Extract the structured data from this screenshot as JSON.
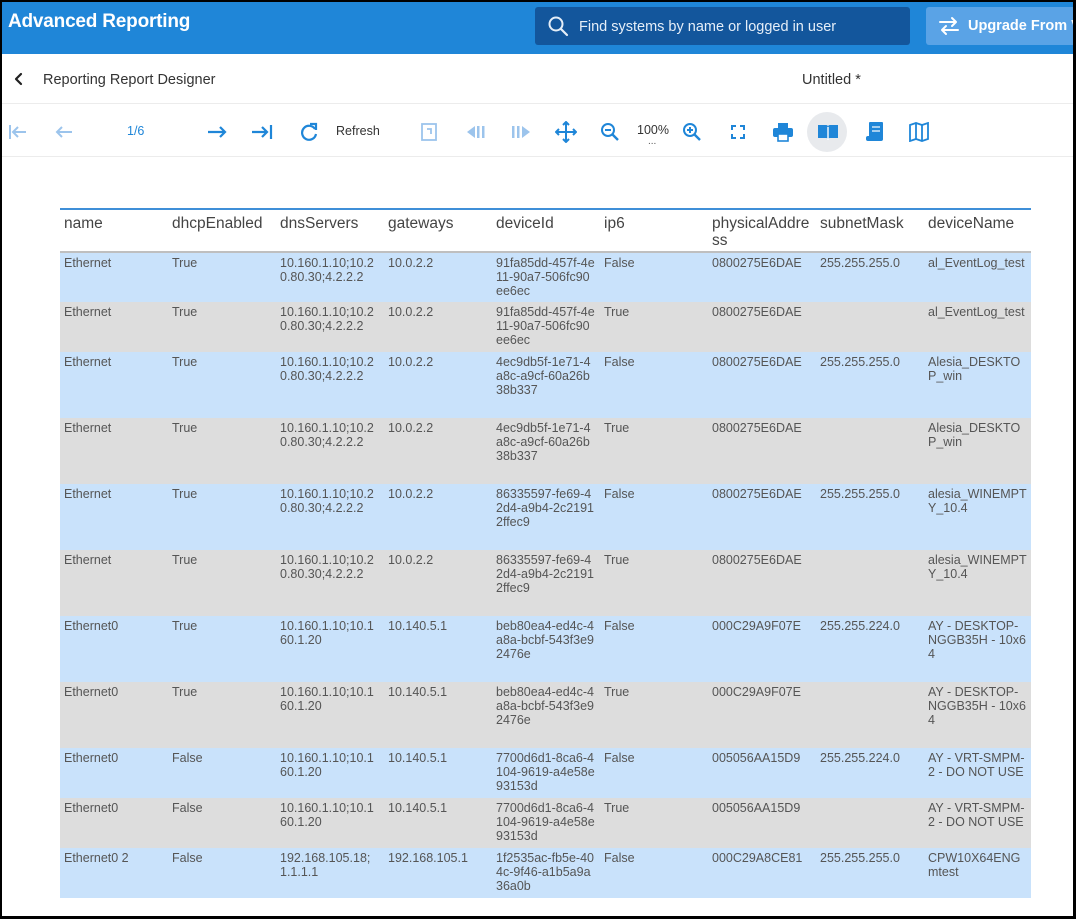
{
  "app": {
    "title": "Advanced Reporting",
    "search_placeholder": "Find systems by name or logged in user",
    "upgrade_label": "Upgrade From V..."
  },
  "subheader": {
    "breadcrumb": "Reporting Report Designer",
    "doc_title": "Untitled *"
  },
  "toolbar": {
    "page_indicator": "1/6",
    "refresh_label": "Refresh",
    "zoom_level": "100%",
    "zoom_more": "..."
  },
  "colors": {
    "appbar": "#1f86d8",
    "search_bg": "#13569c",
    "upgrade_bg": "#5aa3e6",
    "row_blue": "#c9e2fb",
    "row_gray": "#dddddd",
    "header_rule": "#3f8fd8"
  },
  "icons": [
    "back-chevron-icon",
    "search-icon",
    "swap-arrows-icon",
    "first-page-icon",
    "prev-page-icon",
    "next-page-icon",
    "last-page-icon",
    "refresh-icon",
    "export-icon",
    "prev-section-icon",
    "next-section-icon",
    "pan-icon",
    "zoom-out-icon",
    "zoom-in-icon",
    "fullscreen-icon",
    "print-icon",
    "book-icon",
    "scroll-icon",
    "map-icon"
  ],
  "table": {
    "columns": [
      "name",
      "dhcpEnabled",
      "dnsServers",
      "gateways",
      "deviceId",
      "ip6",
      "physicalAddress",
      "subnetMask",
      "deviceName"
    ],
    "rows": [
      [
        "Ethernet",
        "True",
        "10.160.1.10;10.20.80.30;4.2.2.2",
        "10.0.2.2",
        "91fa85dd-457f-4e11-90a7-506fc90ee6ec",
        "False",
        "0800275E6DAE",
        "255.255.255.0",
        "al_EventLog_test"
      ],
      [
        "Ethernet",
        "True",
        "10.160.1.10;10.20.80.30;4.2.2.2",
        "10.0.2.2",
        "91fa85dd-457f-4e11-90a7-506fc90ee6ec",
        "True",
        "0800275E6DAE",
        "",
        "al_EventLog_test"
      ],
      [
        "Ethernet",
        "True",
        "10.160.1.10;10.20.80.30;4.2.2.2",
        "10.0.2.2",
        "4ec9db5f-1e71-4a8c-a9cf-60a26b38b337",
        "False",
        "0800275E6DAE",
        "255.255.255.0",
        "Alesia_DESKTOP_win"
      ],
      [
        "Ethernet",
        "True",
        "10.160.1.10;10.20.80.30;4.2.2.2",
        "10.0.2.2",
        "4ec9db5f-1e71-4a8c-a9cf-60a26b38b337",
        "True",
        "0800275E6DAE",
        "",
        "Alesia_DESKTOP_win"
      ],
      [
        "Ethernet",
        "True",
        "10.160.1.10;10.20.80.30;4.2.2.2",
        "10.0.2.2",
        "86335597-fe69-42d4-a9b4-2c21912ffec9",
        "False",
        "0800275E6DAE",
        "255.255.255.0",
        "alesia_WINEMPTY_10.4"
      ],
      [
        "Ethernet",
        "True",
        "10.160.1.10;10.20.80.30;4.2.2.2",
        "10.0.2.2",
        "86335597-fe69-42d4-a9b4-2c21912ffec9",
        "True",
        "0800275E6DAE",
        "",
        "alesia_WINEMPTY_10.4"
      ],
      [
        "Ethernet0",
        "True",
        "10.160.1.10;10.160.1.20",
        "10.140.5.1",
        "beb80ea4-ed4c-4a8a-bcbf-543f3e92476e",
        "False",
        "000C29A9F07E",
        "255.255.224.0",
        "AY - DESKTOP-NGGB35H - 10x64"
      ],
      [
        "Ethernet0",
        "True",
        "10.160.1.10;10.160.1.20",
        "10.140.5.1",
        "beb80ea4-ed4c-4a8a-bcbf-543f3e92476e",
        "True",
        "000C29A9F07E",
        "",
        "AY - DESKTOP-NGGB35H - 10x64"
      ],
      [
        "Ethernet0",
        "False",
        "10.160.1.10;10.160.1.20",
        "10.140.5.1",
        "7700d6d1-8ca6-4104-9619-a4e58e93153d",
        "False",
        "005056AA15D9",
        "255.255.224.0",
        "AY - VRT-SMPM-2 - DO NOT USE"
      ],
      [
        "Ethernet0",
        "False",
        "10.160.1.10;10.160.1.20",
        "10.140.5.1",
        "7700d6d1-8ca6-4104-9619-a4e58e93153d",
        "True",
        "005056AA15D9",
        "",
        "AY - VRT-SMPM-2 - DO NOT USE"
      ],
      [
        "Ethernet0 2",
        "False",
        "192.168.105.18; 1.1.1.1",
        "192.168.105.1",
        "1f2535ac-fb5e-404c-9f46-a1b5a9a36a0b",
        "False",
        "000C29A8CE81",
        "255.255.255.0",
        "CPW10X64ENGmtest"
      ]
    ]
  }
}
